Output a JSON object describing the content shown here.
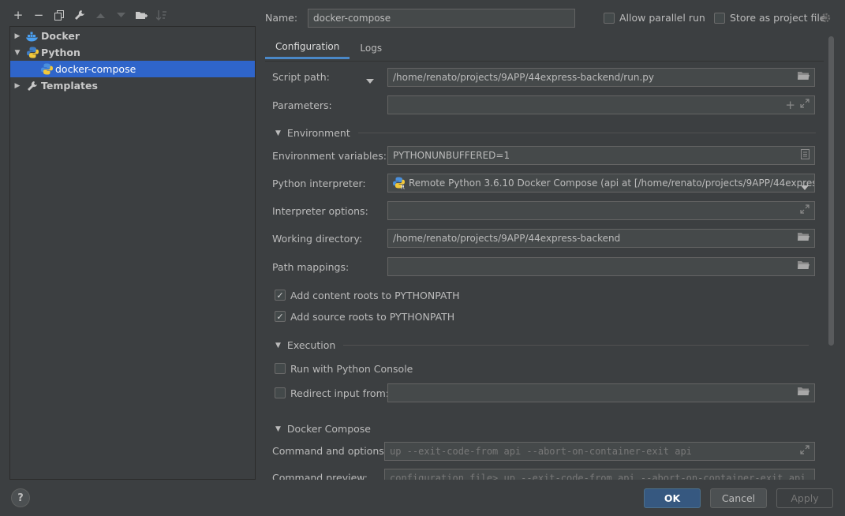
{
  "toolbar": {
    "add": "+",
    "remove": "−"
  },
  "tree": {
    "items": [
      {
        "label": "Docker"
      },
      {
        "label": "Python"
      },
      {
        "label": "docker-compose"
      },
      {
        "label": "Templates"
      }
    ]
  },
  "header": {
    "name_label": "Name:",
    "name_value": "docker-compose",
    "allow_parallel": "Allow parallel run",
    "store_project": "Store as project file"
  },
  "tabs": [
    {
      "label": "Configuration"
    },
    {
      "label": "Logs"
    }
  ],
  "config": {
    "script_path_label": "Script path:",
    "script_path_value": "/home/renato/projects/9APP/44express-backend/run.py",
    "parameters_label": "Parameters:",
    "parameters_value": "",
    "environment_section": "Environment",
    "env_vars_label": "Environment variables:",
    "env_vars_value": "PYTHONUNBUFFERED=1",
    "interpreter_label": "Python interpreter:",
    "interpreter_value": "Remote Python 3.6.10 Docker Compose (api at [/home/renato/projects/9APP/44express-b",
    "interp_options_label": "Interpreter options:",
    "interp_options_value": "",
    "working_dir_label": "Working directory:",
    "working_dir_value": "/home/renato/projects/9APP/44express-backend",
    "path_mappings_label": "Path mappings:",
    "path_mappings_value": "",
    "add_content_roots": "Add content roots to PYTHONPATH",
    "add_source_roots": "Add source roots to PYTHONPATH",
    "execution_section": "Execution",
    "run_console": "Run with Python Console",
    "redirect_input": "Redirect input from:",
    "redirect_value": "",
    "docker_section": "Docker Compose",
    "command_label": "Command and options:",
    "command_value": "up --exit-code-from api --abort-on-container-exit api",
    "preview_label": "Command preview:",
    "preview_value": "configuration file> up --exit-code-from api --abort-on-container-exit api"
  },
  "buttons": {
    "ok": "OK",
    "cancel": "Cancel",
    "apply": "Apply",
    "help": "?"
  },
  "colors": {
    "accent": "#2f65ca",
    "ok_button": "#365880",
    "background": "#3c3f41"
  }
}
